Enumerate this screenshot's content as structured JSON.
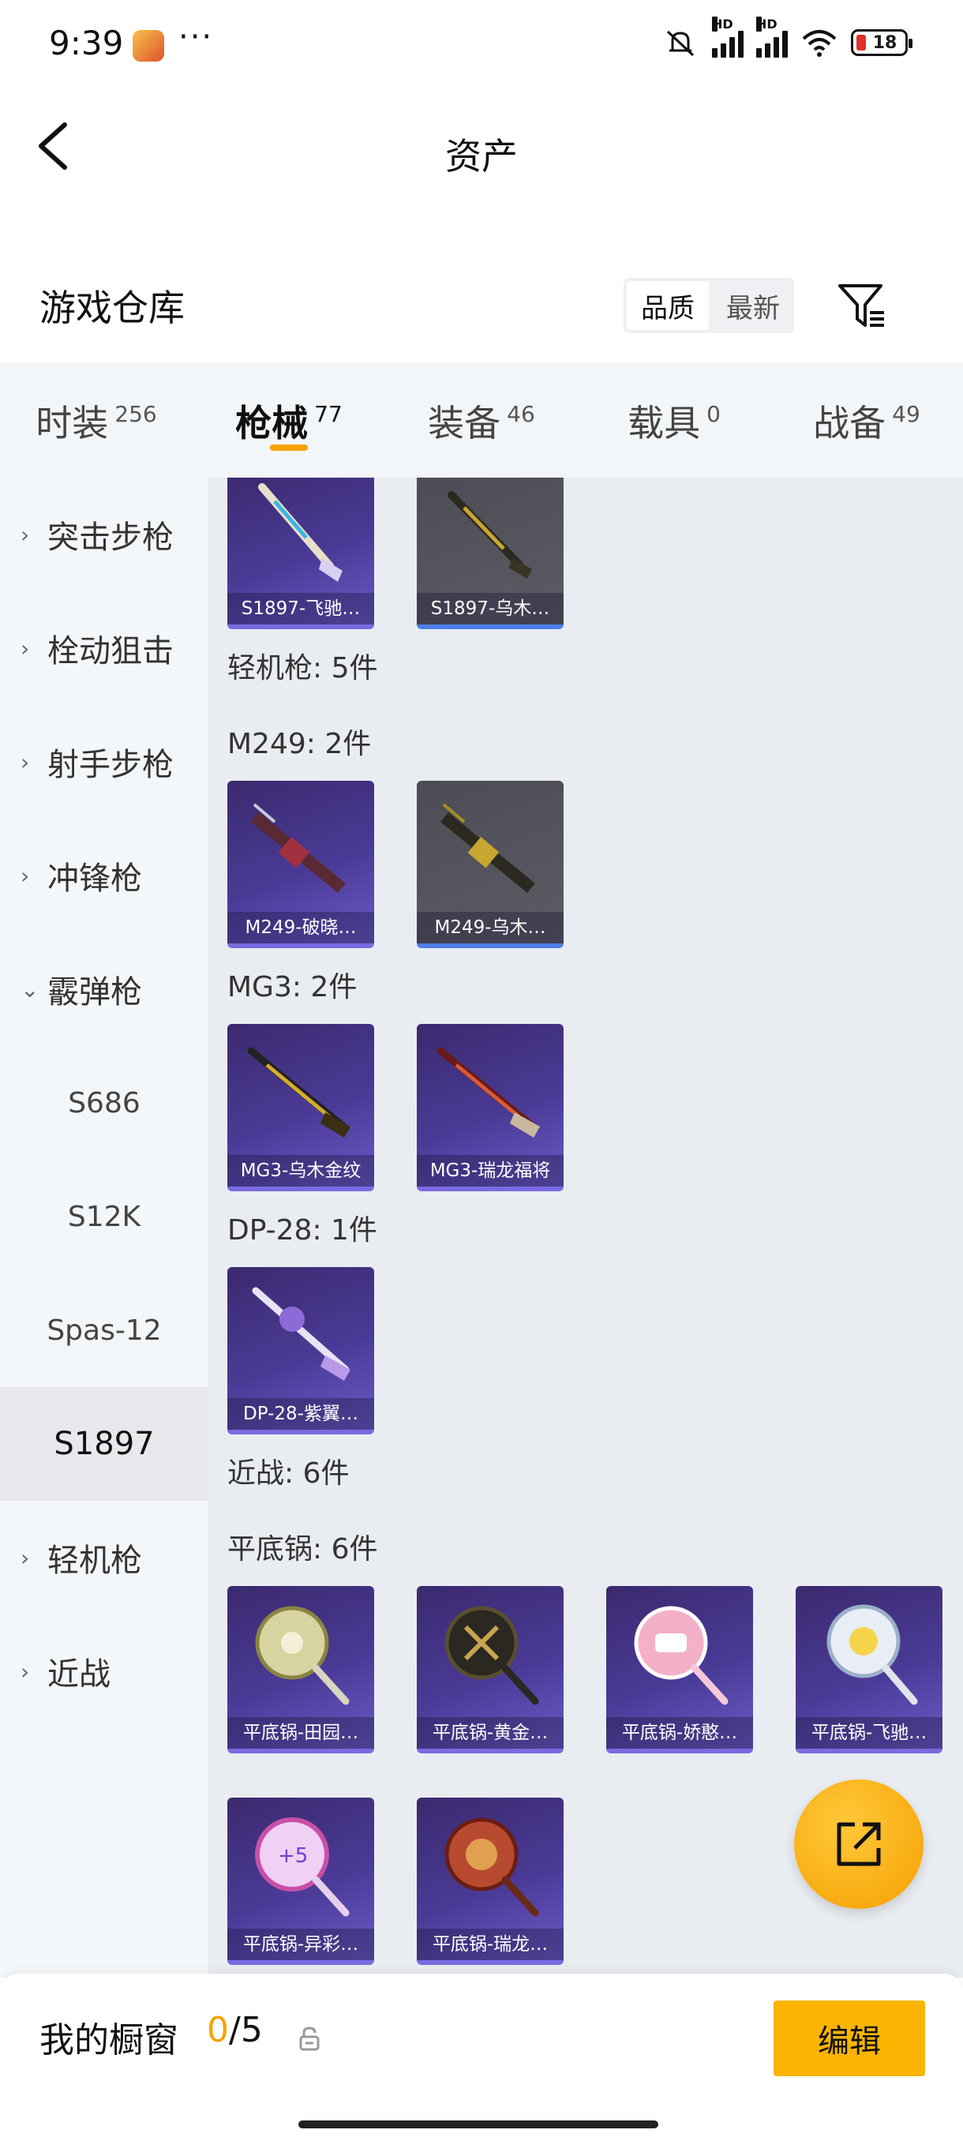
{
  "status_bar": {
    "time": "9:39",
    "dots": "···",
    "battery": "18",
    "signal_tag_1": "HD",
    "signal_tag_2": "HD"
  },
  "header": {
    "title": "资产"
  },
  "section": {
    "title": "游戏仓库",
    "sort_options": [
      "品质",
      "最新"
    ],
    "sort_active": "品质"
  },
  "tabs": [
    {
      "label": "时装",
      "count": "256"
    },
    {
      "label": "枪械",
      "count": "77",
      "active": true
    },
    {
      "label": "装备",
      "count": "46"
    },
    {
      "label": "载具",
      "count": "0"
    },
    {
      "label": "战备",
      "count": "49"
    }
  ],
  "sidebar": {
    "items": [
      {
        "label": "突击步枪",
        "chevron": "›"
      },
      {
        "label": "栓动狙击",
        "chevron": "›"
      },
      {
        "label": "射手步枪",
        "chevron": "›"
      },
      {
        "label": "冲锋枪",
        "chevron": "›"
      },
      {
        "label": "霰弹枪",
        "chevron": "⌄"
      },
      {
        "label": "S686"
      },
      {
        "label": "S12K"
      },
      {
        "label": "Spas-12"
      },
      {
        "label": "S1897",
        "selected": true
      },
      {
        "label": "轻机枪",
        "chevron": "›"
      },
      {
        "label": "近战",
        "chevron": "›"
      }
    ]
  },
  "content": {
    "s1897_items": [
      "S1897-飞驰…",
      "S1897-乌木…"
    ],
    "lmg_group": "轻机枪: 5件",
    "m249_label": "M249: 2件",
    "m249_items": [
      "M249-破晓…",
      "M249-乌木…"
    ],
    "mg3_label": "MG3: 2件",
    "mg3_items": [
      "MG3-乌木金纹",
      "MG3-瑞龙福将"
    ],
    "dp28_label": "DP-28: 1件",
    "dp28_items": [
      "DP-28-紫翼…"
    ],
    "melee_group": "近战: 6件",
    "pan_label": "平底锅: 6件",
    "pan_items": [
      "平底锅-田园…",
      "平底锅-黄金…",
      "平底锅-娇憨…",
      "平底锅-飞驰…",
      "平底锅-异彩…",
      "平底锅-瑞龙…"
    ]
  },
  "bottom": {
    "showcase_label": "我的橱窗",
    "showcase_current": "0",
    "showcase_total": "/5",
    "edit_label": "编辑"
  },
  "colors": {
    "accent": "#f5a300",
    "edit_button": "#f8b400",
    "item_purple": "#4a3a96",
    "item_grey": "#55555e"
  }
}
